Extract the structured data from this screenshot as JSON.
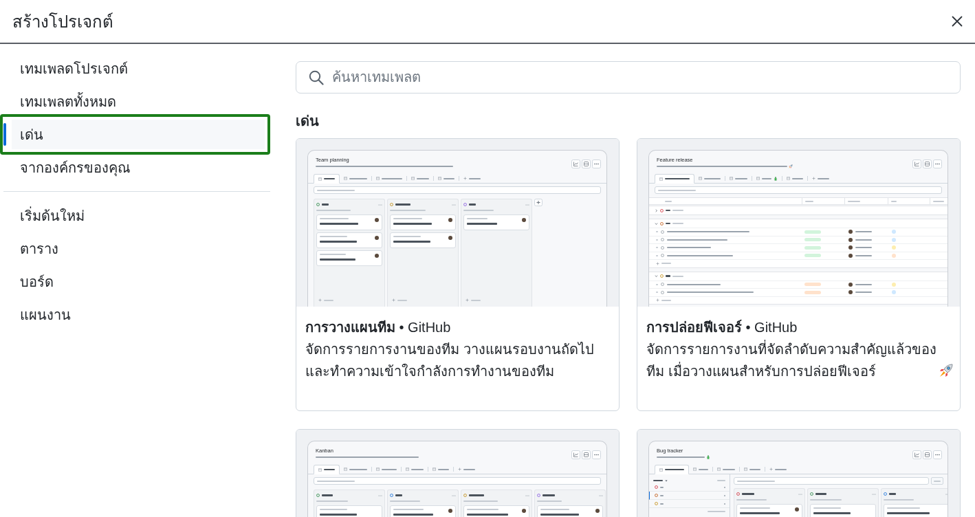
{
  "dialog": {
    "title": "สร้างโปรเจกต์"
  },
  "sidebar": {
    "groups": [
      {
        "items": [
          {
            "label": "เทมเพลดโปรเจกต์",
            "selected": false,
            "focused": false
          },
          {
            "label": "เทมเพลตทั้งหมด",
            "selected": false,
            "focused": false
          },
          {
            "label": "เด่น",
            "selected": true,
            "focused": true
          },
          {
            "label": "จากองค์กรของคุณ",
            "selected": false,
            "focused": false
          }
        ]
      },
      {
        "items": [
          {
            "label": "เริ่มด้นใหม่",
            "selected": false,
            "focused": false
          },
          {
            "label": "ตาราง",
            "selected": false,
            "focused": false
          },
          {
            "label": "บอร์ด",
            "selected": false,
            "focused": false
          },
          {
            "label": "แผนงาน",
            "selected": false,
            "focused": false
          }
        ]
      }
    ]
  },
  "search": {
    "placeholder": "ค้นหาเทมเพลต"
  },
  "featured": {
    "heading": "เด่น",
    "templates": [
      {
        "title": "**การวางแผนทีม** • GitHub",
        "description": "จัดการรายการงานของทีม วางแผนรอบงานถัดไป และทำความเข้าใจกำลังการทำงานของทีม",
        "preview": {
          "title": "Team planning",
          "kind": "planning"
        }
      },
      {
        "title": "**การปล่อยฟีเจอร์** • GitHub",
        "description": "จัดการรายการงานที่จัดลำดับความสำคัญแล้วของทีม เมื่อวางแผนสำหรับการปล่อยฟีเจอร์",
        "preview": {
          "title": "Feature release",
          "kind": "release"
        }
      },
      {
        "preview": {
          "title": "Kanban",
          "kind": "kanban"
        }
      },
      {
        "preview": {
          "title": "Bug tracker",
          "kind": "tracker"
        }
      }
    ]
  }
}
